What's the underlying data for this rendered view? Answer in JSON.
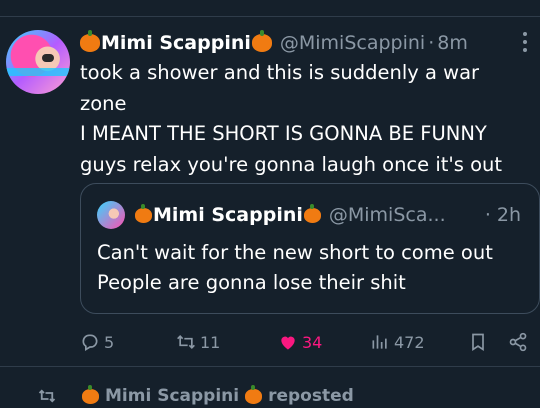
{
  "tweet": {
    "author_name": "Mimi Scappini",
    "handle": "@MimiScappini",
    "separator": "·",
    "time": "8m",
    "lines": [
      "took a shower and this is suddenly a war",
      "zone",
      "I MEANT THE SHORT IS GONNA BE FUNNY",
      "guys relax you're gonna laugh once it's out"
    ]
  },
  "quote": {
    "author_name": "Mimi Scappini",
    "handle": "@MimiSca...",
    "separator": "·",
    "time": "2h",
    "lines": [
      "Can't wait for the new short to come out",
      "People are gonna lose their shit"
    ]
  },
  "actions": {
    "replies": "5",
    "reposts": "11",
    "likes": "34",
    "views": "472"
  },
  "next": {
    "reposter_name": "Mimi Scappini",
    "label": "reposted"
  },
  "colors": {
    "background": "#15202b",
    "secondary_text": "#8b98a5",
    "like": "#f91880",
    "border": "#3d4c5c"
  }
}
